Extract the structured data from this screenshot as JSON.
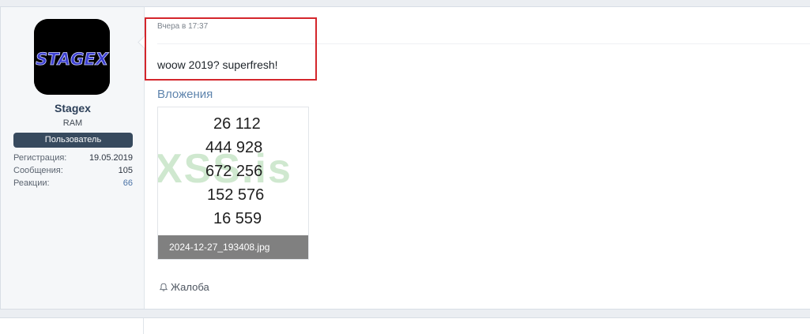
{
  "post": {
    "user": {
      "avatar_text": "STAGEX",
      "username": "Stagex",
      "title": "RAM",
      "banner": "Пользователь",
      "stats": [
        {
          "label": "Регистрация:",
          "value": "19.05.2019"
        },
        {
          "label": "Сообщения:",
          "value": "105"
        },
        {
          "label": "Реакции:",
          "value": "66"
        }
      ]
    },
    "message": {
      "attribution": "Вчера в 17:37",
      "body": "woow 2019? superfresh!"
    },
    "attachments": {
      "title": "Вложения",
      "items": [
        {
          "filename": "2024-12-27_193408.jpg",
          "preview_numbers": [
            "26 112",
            "444 928",
            "672 256",
            "152 576",
            "16 559"
          ],
          "watermark": "XSS.is"
        }
      ]
    },
    "actions": {
      "report_label": "Жалоба",
      "report_icon": "bell-icon"
    }
  },
  "colors": {
    "highlight_border": "#d4262c",
    "banner_bg": "#374a5e",
    "link": "#5e84ad"
  }
}
